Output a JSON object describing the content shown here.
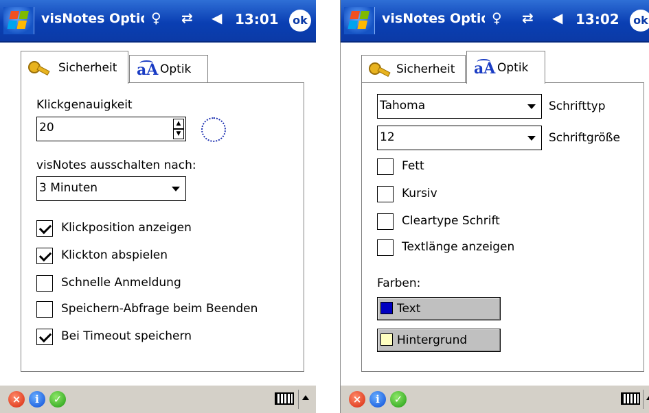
{
  "left_screen": {
    "window_title": "visNotes Optionen",
    "time": "13:01",
    "ok_label": "ok",
    "tabs": [
      {
        "label": "Sicherheit",
        "active": true
      },
      {
        "label": "Optik",
        "active": false
      }
    ],
    "click_accuracy": {
      "label": "Klickgenauigkeit",
      "value": "20"
    },
    "shutdown": {
      "label": "visNotes ausschalten nach:",
      "selected": "3 Minuten"
    },
    "checkboxes": [
      {
        "label": "Klickposition anzeigen",
        "checked": true
      },
      {
        "label": "Klickton abspielen",
        "checked": true
      },
      {
        "label": "Schnelle Anmeldung",
        "checked": false
      },
      {
        "label": "Speichern-Abfrage beim Beenden",
        "checked": false
      },
      {
        "label": "Bei Timeout speichern",
        "checked": true
      }
    ]
  },
  "right_screen": {
    "window_title": "visNotes Optionen",
    "time": "13:02",
    "ok_label": "ok",
    "tabs": [
      {
        "label": "Sicherheit",
        "active": false
      },
      {
        "label": "Optik",
        "active": true
      }
    ],
    "font_type": {
      "value": "Tahoma",
      "label": "Schrifttyp"
    },
    "font_size": {
      "value": "12",
      "label": "Schriftgröße"
    },
    "checkboxes": [
      {
        "label": "Fett",
        "checked": false
      },
      {
        "label": "Kursiv",
        "checked": false
      },
      {
        "label": "Cleartype Schrift",
        "checked": false
      },
      {
        "label": "Textlänge anzeigen",
        "checked": false
      }
    ],
    "colors_label": "Farben:",
    "color_buttons": [
      {
        "label": "Text",
        "swatch": "#0000c0"
      },
      {
        "label": "Hintergrund",
        "swatch": "#ffffc0"
      }
    ]
  },
  "icons": {
    "start": "windows-flag-icon",
    "wifi": "antenna-icon",
    "connection": "connectivity-arrows-icon",
    "volume": "speaker-icon",
    "security_tab": "key-icon",
    "optik_tab": "font-icon",
    "cancel": "cancel-icon",
    "info": "info-icon",
    "accept": "check-icon",
    "keyboard": "keyboard-icon"
  },
  "theme": {
    "titlebar_color": "#0b3aa6",
    "taskbar_color": "#d4d0c8",
    "button_color": "#c0c0c0"
  }
}
